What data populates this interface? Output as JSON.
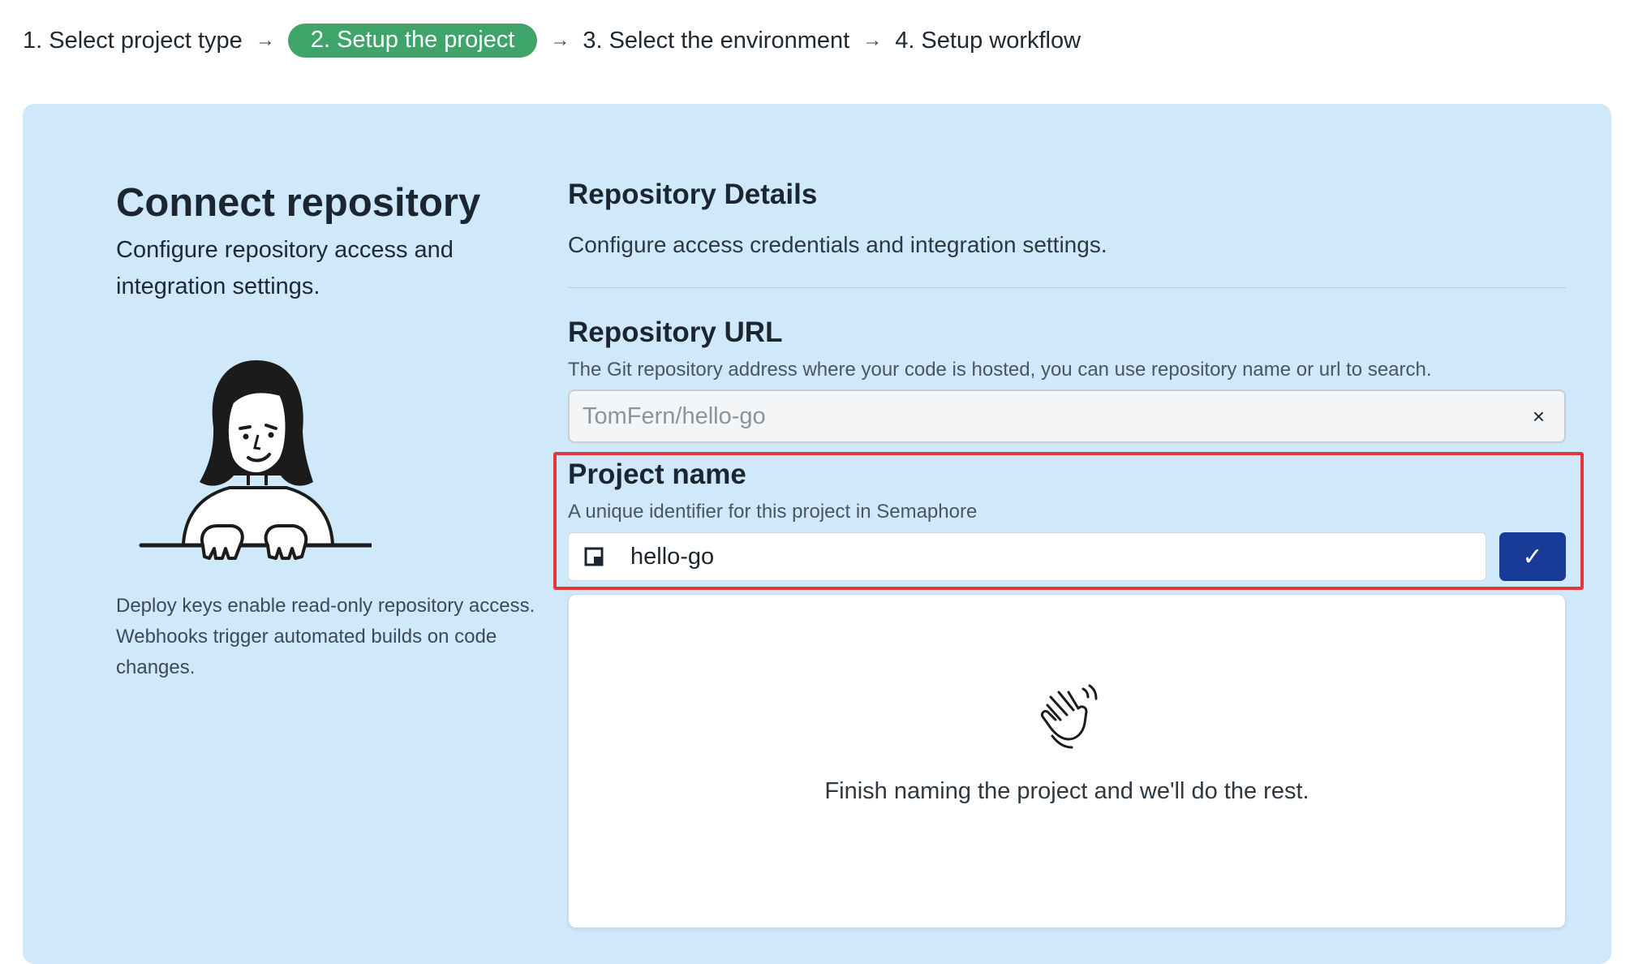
{
  "stepper": {
    "steps": [
      {
        "label": "1. Select project type"
      },
      {
        "label": "2. Setup the project"
      },
      {
        "label": "3. Select the environment"
      },
      {
        "label": "4. Setup workflow"
      }
    ],
    "arrow": "→",
    "active_index": 1,
    "active_color": "#3fa46a"
  },
  "left": {
    "title": "Connect repository",
    "subtitle": "Configure repository access and integration settings.",
    "illustration_icon": "person-at-desk-illustration",
    "note": "Deploy keys enable read-only repository access. Webhooks trigger automated builds on code changes."
  },
  "details": {
    "title": "Repository Details",
    "subtitle": "Configure access credentials and integration settings."
  },
  "repo_url": {
    "label": "Repository URL",
    "help": "The Git repository address where your code is hosted, you can use repository name or url to search.",
    "value": "TomFern/hello-go",
    "clear_glyph": "×"
  },
  "project_name": {
    "label": "Project name",
    "help": "A unique identifier for this project in Semaphore",
    "value": "hello-go",
    "input_icon": "project-icon",
    "confirm_glyph": "✓",
    "confirm_color": "#173b96",
    "highlight_color": "#e0383e"
  },
  "result": {
    "icon": "waving-hand-icon",
    "message": "Finish naming the project and we'll do the rest."
  },
  "colors": {
    "panel_bg": "#cfe9fb"
  }
}
